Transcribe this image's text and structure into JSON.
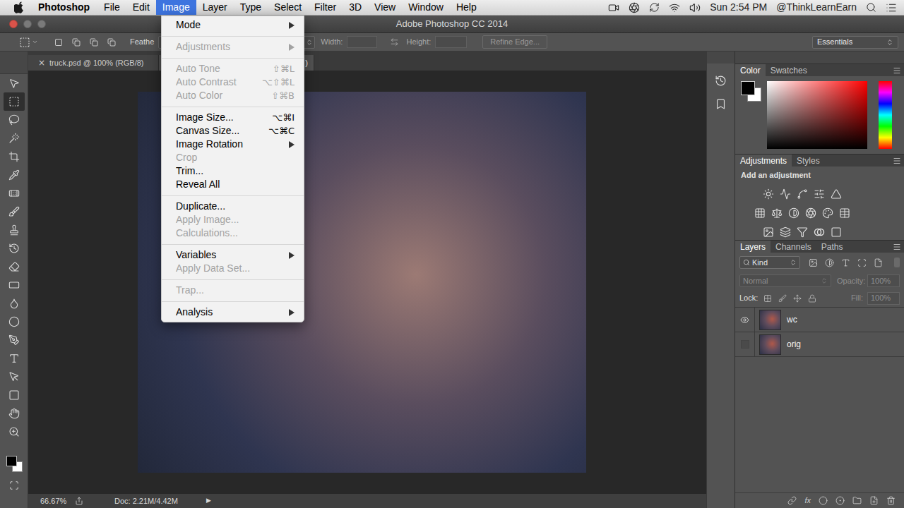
{
  "menubar": {
    "app": "Photoshop",
    "items": [
      {
        "label": "File",
        "selected": false
      },
      {
        "label": "Edit",
        "selected": false
      },
      {
        "label": "Image",
        "selected": true
      },
      {
        "label": "Layer",
        "selected": false
      },
      {
        "label": "Type",
        "selected": false
      },
      {
        "label": "Select",
        "selected": false
      },
      {
        "label": "Filter",
        "selected": false
      },
      {
        "label": "3D",
        "selected": false
      },
      {
        "label": "View",
        "selected": false
      },
      {
        "label": "Window",
        "selected": false
      },
      {
        "label": "Help",
        "selected": false
      }
    ],
    "clock": "Sun 2:54 PM",
    "user": "@ThinkLearnEarn"
  },
  "window": {
    "title": "Adobe Photoshop CC 2014"
  },
  "options_bar": {
    "feather": "Feathe",
    "width_label": "Width:",
    "height_label": "Height:",
    "refine_edge": {
      "label": "Refine Edge...",
      "disabled": true
    },
    "workspace": "Essentials"
  },
  "document_tabs": [
    {
      "label": "truck.psd @ 100% (RGB/8)",
      "close": "×",
      "selected": false
    },
    {
      "label": ")",
      "selected": true
    }
  ],
  "tools": [
    {
      "selected": false
    },
    {
      "selected": true
    },
    {
      "selected": false
    },
    {
      "selected": false
    },
    {
      "selected": false
    },
    {
      "selected": false
    },
    {
      "selected": false
    },
    {
      "selected": false
    },
    {
      "selected": false
    },
    {
      "selected": false
    },
    {
      "selected": false
    },
    {
      "selected": false
    },
    {
      "selected": false
    },
    {
      "selected": false
    },
    {
      "selected": false
    },
    {
      "selected": false
    },
    {
      "selected": false
    },
    {
      "selected": false
    },
    {
      "selected": false
    },
    {
      "selected": false
    }
  ],
  "image_menu": [
    {
      "kind": "item",
      "label": "Mode",
      "shortcut": "",
      "disabled": false,
      "submenu": true
    },
    {
      "kind": "separator"
    },
    {
      "kind": "item",
      "label": "Adjustments",
      "shortcut": "",
      "disabled": true,
      "submenu": true
    },
    {
      "kind": "separator"
    },
    {
      "kind": "item",
      "label": "Auto Tone",
      "shortcut": "⇧⌘L",
      "disabled": true,
      "submenu": false
    },
    {
      "kind": "item",
      "label": "Auto Contrast",
      "shortcut": "⌥⇧⌘L",
      "disabled": true,
      "submenu": false
    },
    {
      "kind": "item",
      "label": "Auto Color",
      "shortcut": "⇧⌘B",
      "disabled": true,
      "submenu": false
    },
    {
      "kind": "separator"
    },
    {
      "kind": "item",
      "label": "Image Size...",
      "shortcut": "⌥⌘I",
      "disabled": false,
      "submenu": false
    },
    {
      "kind": "item",
      "label": "Canvas Size...",
      "shortcut": "⌥⌘C",
      "disabled": false,
      "submenu": false
    },
    {
      "kind": "item",
      "label": "Image Rotation",
      "shortcut": "",
      "disabled": false,
      "submenu": true
    },
    {
      "kind": "item",
      "label": "Crop",
      "shortcut": "",
      "disabled": true,
      "submenu": false
    },
    {
      "kind": "item",
      "label": "Trim...",
      "shortcut": "",
      "disabled": false,
      "submenu": false
    },
    {
      "kind": "item",
      "label": "Reveal All",
      "shortcut": "",
      "disabled": false,
      "submenu": false
    },
    {
      "kind": "separator"
    },
    {
      "kind": "item",
      "label": "Duplicate...",
      "shortcut": "",
      "disabled": false,
      "submenu": false
    },
    {
      "kind": "item",
      "label": "Apply Image...",
      "shortcut": "",
      "disabled": true,
      "submenu": false
    },
    {
      "kind": "item",
      "label": "Calculations...",
      "shortcut": "",
      "disabled": true,
      "submenu": false
    },
    {
      "kind": "separator"
    },
    {
      "kind": "item",
      "label": "Variables",
      "shortcut": "",
      "disabled": false,
      "submenu": true
    },
    {
      "kind": "item",
      "label": "Apply Data Set...",
      "shortcut": "",
      "disabled": true,
      "submenu": false
    },
    {
      "kind": "separator"
    },
    {
      "kind": "item",
      "label": "Trap...",
      "shortcut": "",
      "disabled": true,
      "submenu": false
    },
    {
      "kind": "separator"
    },
    {
      "kind": "item",
      "label": "Analysis",
      "shortcut": "",
      "disabled": false,
      "submenu": true
    }
  ],
  "status_bar": {
    "zoom": "66.67%",
    "doc": "Doc: 2.21M/4.42M",
    "arrow": "▶"
  },
  "color_panel": {
    "tabs": [
      {
        "label": "Color",
        "selected": true
      },
      {
        "label": "Swatches",
        "selected": false
      }
    ]
  },
  "adjustments_panel": {
    "tabs": [
      {
        "label": "Adjustments",
        "selected": true
      },
      {
        "label": "Styles",
        "selected": false
      }
    ],
    "hint": "Add an adjustment"
  },
  "layers_panel": {
    "tabs": [
      {
        "label": "Layers",
        "selected": true
      },
      {
        "label": "Channels",
        "selected": false
      },
      {
        "label": "Paths",
        "selected": false
      }
    ],
    "filter": "Kind",
    "blend_mode": {
      "label": "Normal",
      "disabled": true
    },
    "opacity": {
      "label": "Opacity:",
      "value": "100%",
      "disabled": true
    },
    "lock_label": "Lock:",
    "fill": {
      "label": "Fill:",
      "value": "100%",
      "disabled": true
    },
    "layers": [
      {
        "name": "wc",
        "visible": true,
        "selected": false
      },
      {
        "name": "orig",
        "visible": false,
        "selected": false
      }
    ],
    "fx_button": "fx"
  }
}
